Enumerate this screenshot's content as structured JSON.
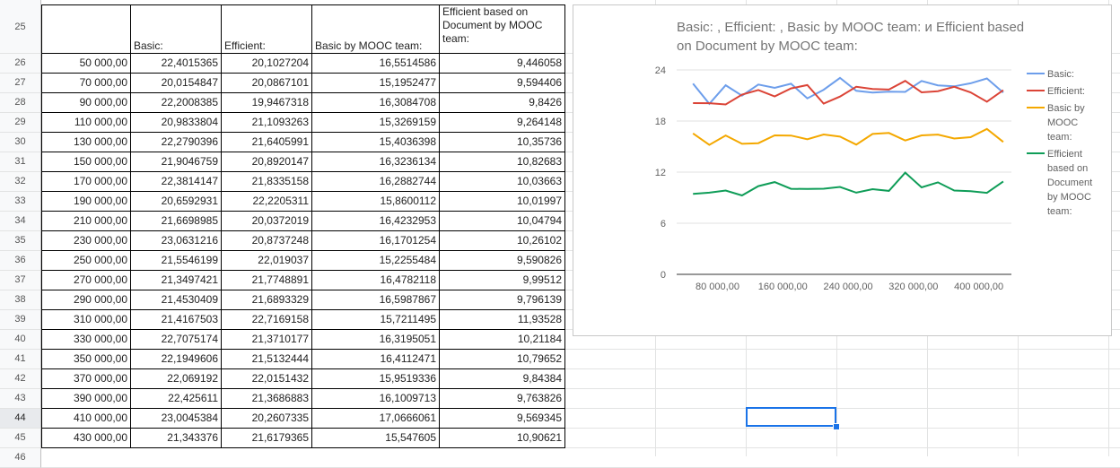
{
  "sheet": {
    "row_numbers": [
      "25",
      "26",
      "27",
      "28",
      "29",
      "30",
      "31",
      "32",
      "33",
      "34",
      "35",
      "36",
      "37",
      "38",
      "39",
      "40",
      "41",
      "42",
      "43",
      "44",
      "45",
      "46"
    ],
    "selected_row": "44",
    "headers": {
      "a": "",
      "b": "Basic:",
      "c": "Efficient:",
      "d": "Basic by MOOC team:",
      "e": "Efficient based on Document by MOOC team:"
    },
    "rows": [
      [
        "50 000,00",
        "22,4015365",
        "20,1027204",
        "16,5514586",
        "9,446058"
      ],
      [
        "70 000,00",
        "20,0154847",
        "20,0867101",
        "15,1952477",
        "9,594406"
      ],
      [
        "90 000,00",
        "22,2008385",
        "19,9467318",
        "16,3084708",
        "9,8426"
      ],
      [
        "110 000,00",
        "20,9833804",
        "21,1093263",
        "15,3269159",
        "9,264148"
      ],
      [
        "130 000,00",
        "22,2790396",
        "21,6405991",
        "15,4036398",
        "10,35736"
      ],
      [
        "150 000,00",
        "21,9046759",
        "20,8920147",
        "16,3236134",
        "10,82683"
      ],
      [
        "170 000,00",
        "22,3814147",
        "21,8335158",
        "16,2882744",
        "10,03663"
      ],
      [
        "190 000,00",
        "20,6592931",
        "22,2205311",
        "15,8600112",
        "10,01997"
      ],
      [
        "210 000,00",
        "21,6698985",
        "20,0372019",
        "16,4232953",
        "10,04794"
      ],
      [
        "230 000,00",
        "23,0631216",
        "20,8737248",
        "16,1701254",
        "10,26102"
      ],
      [
        "250 000,00",
        "21,5546199",
        "22,019037",
        "15,2255484",
        "9,590826"
      ],
      [
        "270 000,00",
        "21,3497421",
        "21,7748891",
        "16,4782118",
        "9,99512"
      ],
      [
        "290 000,00",
        "21,4530409",
        "21,6893329",
        "16,5987867",
        "9,796139"
      ],
      [
        "310 000,00",
        "21,4167503",
        "22,7169158",
        "15,7211495",
        "11,93528"
      ],
      [
        "330 000,00",
        "22,7075174",
        "21,3710177",
        "16,3195051",
        "10,21184"
      ],
      [
        "350 000,00",
        "22,1949606",
        "21,5132444",
        "16,4112471",
        "10,79652"
      ],
      [
        "370 000,00",
        "22,069192",
        "22,0151432",
        "15,9519336",
        "9,84384"
      ],
      [
        "390 000,00",
        "22,425611",
        "21,3686883",
        "16,1009713",
        "9,763826"
      ],
      [
        "410 000,00",
        "23,0045384",
        "20,2607335",
        "17,0666061",
        "9,569345"
      ],
      [
        "430 000,00",
        "21,343376",
        "21,6179365",
        "15,547605",
        "10,90621"
      ]
    ]
  },
  "chart_data": {
    "type": "line",
    "title": "Basic: , Efficient: , Basic by MOOC team: и Efficient based on Document by MOOC team:",
    "x": [
      50000,
      70000,
      90000,
      110000,
      130000,
      150000,
      170000,
      190000,
      210000,
      230000,
      250000,
      270000,
      290000,
      310000,
      330000,
      350000,
      370000,
      390000,
      410000,
      430000
    ],
    "x_ticks": [
      "80 000,00",
      "160 000,00",
      "240 000,00",
      "320 000,00",
      "400 000,00"
    ],
    "x_tick_values": [
      80000,
      160000,
      240000,
      320000,
      400000
    ],
    "y_ticks": [
      "0",
      "6",
      "12",
      "18",
      "24"
    ],
    "y_tick_values": [
      0,
      6,
      12,
      18,
      24
    ],
    "xlim": [
      30000,
      440000
    ],
    "ylim": [
      0,
      24
    ],
    "grid": true,
    "legend_position": "right",
    "series": [
      {
        "name": "Basic:",
        "legend_lines": [
          "Basic:"
        ],
        "color": "#6d9eeb",
        "values": [
          22.4,
          20.02,
          22.2,
          20.98,
          22.28,
          21.9,
          22.38,
          20.66,
          21.67,
          23.06,
          21.55,
          21.35,
          21.45,
          21.42,
          22.71,
          22.19,
          22.07,
          22.43,
          23.0,
          21.34
        ]
      },
      {
        "name": "Efficient:",
        "legend_lines": [
          "Efficient:"
        ],
        "color": "#db4437",
        "values": [
          20.1,
          20.09,
          19.95,
          21.11,
          21.64,
          20.89,
          21.83,
          22.22,
          20.04,
          20.87,
          22.02,
          21.77,
          21.69,
          22.72,
          21.37,
          21.51,
          22.02,
          21.37,
          20.26,
          21.62
        ]
      },
      {
        "name": "Basic by MOOC team:",
        "legend_lines": [
          "Basic by",
          "MOOC",
          "team:"
        ],
        "color": "#f4a800",
        "values": [
          16.55,
          15.2,
          16.31,
          15.33,
          15.4,
          16.32,
          16.29,
          15.86,
          16.42,
          16.17,
          15.23,
          16.48,
          16.6,
          15.72,
          16.32,
          16.41,
          15.95,
          16.1,
          17.07,
          15.55
        ]
      },
      {
        "name": "Efficient based on Document by MOOC team:",
        "legend_lines": [
          "Efficient",
          "based on",
          "Document",
          "by MOOC",
          "team:"
        ],
        "color": "#0f9d58",
        "values": [
          9.45,
          9.59,
          9.84,
          9.26,
          10.36,
          10.83,
          10.04,
          10.02,
          10.05,
          10.26,
          9.59,
          10.0,
          9.8,
          11.94,
          10.21,
          10.8,
          9.84,
          9.76,
          9.57,
          10.91
        ]
      }
    ]
  }
}
